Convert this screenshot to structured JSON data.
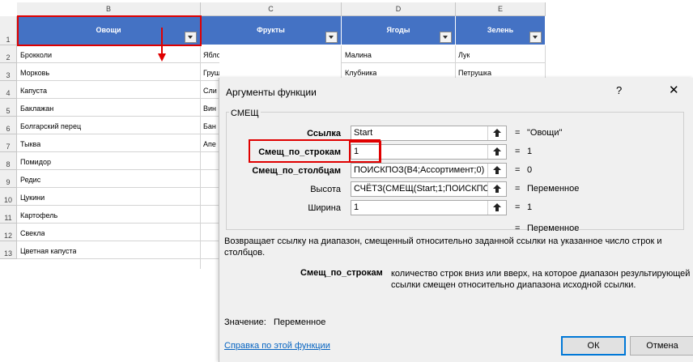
{
  "sheet": {
    "columns": [
      "B",
      "C",
      "D",
      "E"
    ],
    "rows": [
      "1",
      "2",
      "3",
      "4",
      "5",
      "6",
      "7",
      "8",
      "9",
      "10",
      "11",
      "12",
      "13"
    ],
    "headers": [
      "Овощи",
      "Фрукты",
      "Ягоды",
      "Зелень"
    ],
    "vegetables": [
      "Брокколи",
      "Морковь",
      "Капуста",
      "Баклажан",
      "Болгарский перец",
      "Тыква",
      "Помидор",
      "Редис",
      "Цукини",
      "Картофель",
      "Свекла",
      "Цветная капуста"
    ],
    "fruits": [
      "Яблоки",
      "Груши",
      "Сли",
      "Вин",
      "Бан",
      "Апе"
    ],
    "berries": [
      "Малина",
      "Клубника"
    ],
    "greens": [
      "Лук",
      "Петрушка"
    ]
  },
  "dialog": {
    "title": "Аргументы функции",
    "help_glyph": "?",
    "close_glyph": "✕",
    "function_name": "СМЕЩ",
    "args": [
      {
        "label": "Ссылка",
        "value": "Start",
        "result": "\"Овощи\""
      },
      {
        "label": "Смещ_по_строкам",
        "value": "1",
        "result": "1"
      },
      {
        "label": "Смещ_по_столбцам",
        "value": "ПОИСКПОЗ(B4;Ассортимент;0)",
        "result": "0"
      },
      {
        "label": "Высота",
        "value": "СЧЁТЗ(СМЕЩ(Start;1;ПОИСКПС",
        "result": "Переменное"
      },
      {
        "label": "Ширина",
        "value": "1",
        "result": "1"
      }
    ],
    "eq": "=",
    "overall_result": "Переменное",
    "description": "Возвращает ссылку на диапазон, смещенный относительно заданной ссылки на указанное число строк и столбцов.",
    "param_name": "Смещ_по_строкам",
    "param_description": "количество строк вниз или вверх, на которое диапазон результирующей ссылки смещен относительно диапазона исходной ссылки.",
    "value_label": "Значение:",
    "value_text": "Переменное",
    "help_link": "Справка по этой функции",
    "ok_label": "ОК",
    "cancel_label": "Отмена"
  },
  "colors": {
    "header_fill": "#4472c4",
    "highlight": "#e00000",
    "link": "#0563c1"
  }
}
